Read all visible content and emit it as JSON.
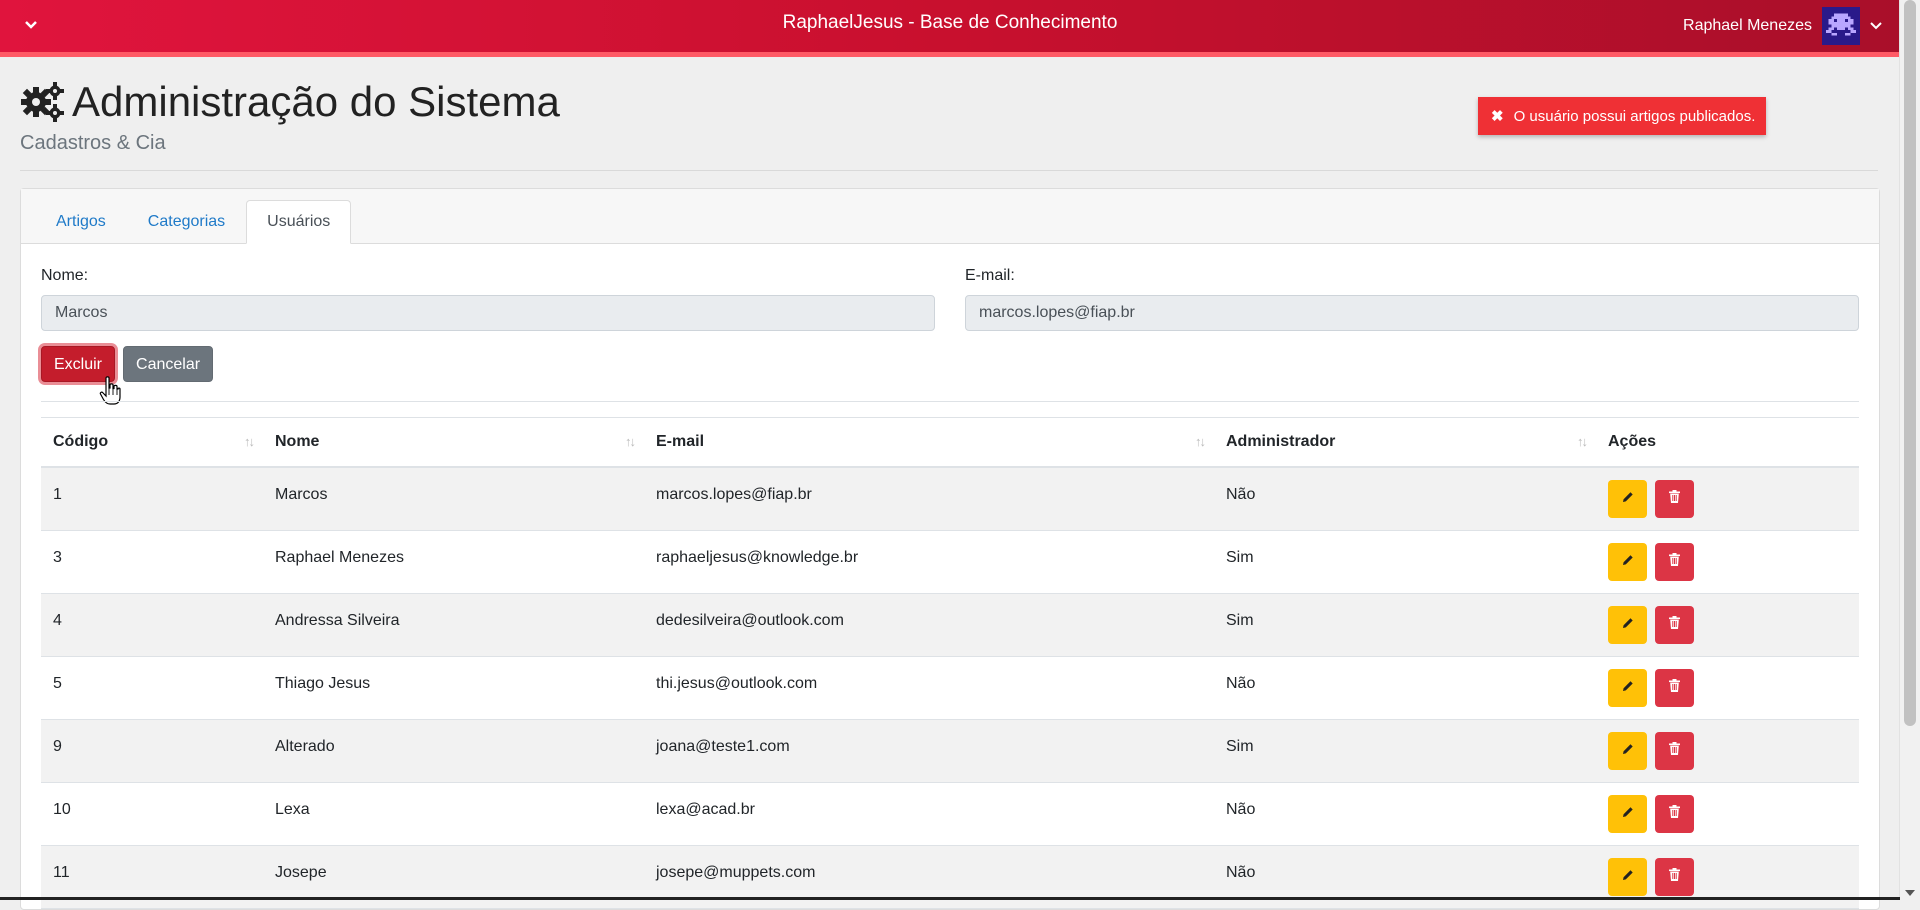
{
  "header": {
    "title": "RaphaelJesus - Base de Conhecimento",
    "user_name": "Raphael Menezes",
    "icons": {
      "menu_toggle": "chevron-down-icon",
      "user_menu": "chevron-down-icon",
      "avatar": "pixel-invader-avatar"
    }
  },
  "page": {
    "title": "Administração do Sistema",
    "subtitle": "Cadastros & Cia",
    "title_icon": "gears-icon"
  },
  "alert": {
    "icon": "close-icon",
    "message": "O usuário possui artigos publicados.",
    "color": "#ef3035"
  },
  "tabs": [
    {
      "label": "Artigos",
      "active": false
    },
    {
      "label": "Categorias",
      "active": false
    },
    {
      "label": "Usuários",
      "active": true
    }
  ],
  "form": {
    "name_label": "Nome:",
    "name_value": "Marcos",
    "email_label": "E-mail:",
    "email_value": "marcos.lopes@fiap.br",
    "delete_label": "Excluir",
    "cancel_label": "Cancelar"
  },
  "table": {
    "columns": [
      "Código",
      "Nome",
      "E-mail",
      "Administrador",
      "Ações"
    ],
    "rows": [
      {
        "code": "1",
        "name": "Marcos",
        "email": "marcos.lopes@fiap.br",
        "admin": "Não"
      },
      {
        "code": "3",
        "name": "Raphael Menezes",
        "email": "raphaeljesus@knowledge.br",
        "admin": "Sim"
      },
      {
        "code": "4",
        "name": "Andressa Silveira",
        "email": "dedesilveira@outlook.com",
        "admin": "Sim"
      },
      {
        "code": "5",
        "name": "Thiago Jesus",
        "email": "thi.jesus@outlook.com",
        "admin": "Não"
      },
      {
        "code": "9",
        "name": "Alterado",
        "email": "joana@teste1.com",
        "admin": "Sim"
      },
      {
        "code": "10",
        "name": "Lexa",
        "email": "lexa@acad.br",
        "admin": "Não"
      },
      {
        "code": "11",
        "name": "Josepe",
        "email": "josepe@muppets.com",
        "admin": "Não"
      }
    ],
    "action_icons": {
      "edit": "pencil-icon",
      "delete": "trash-icon"
    }
  },
  "colors": {
    "header": "#c8102e",
    "danger": "#dc3545",
    "warning": "#ffc107",
    "secondary": "#6c757d",
    "link": "#1f7ac8"
  }
}
